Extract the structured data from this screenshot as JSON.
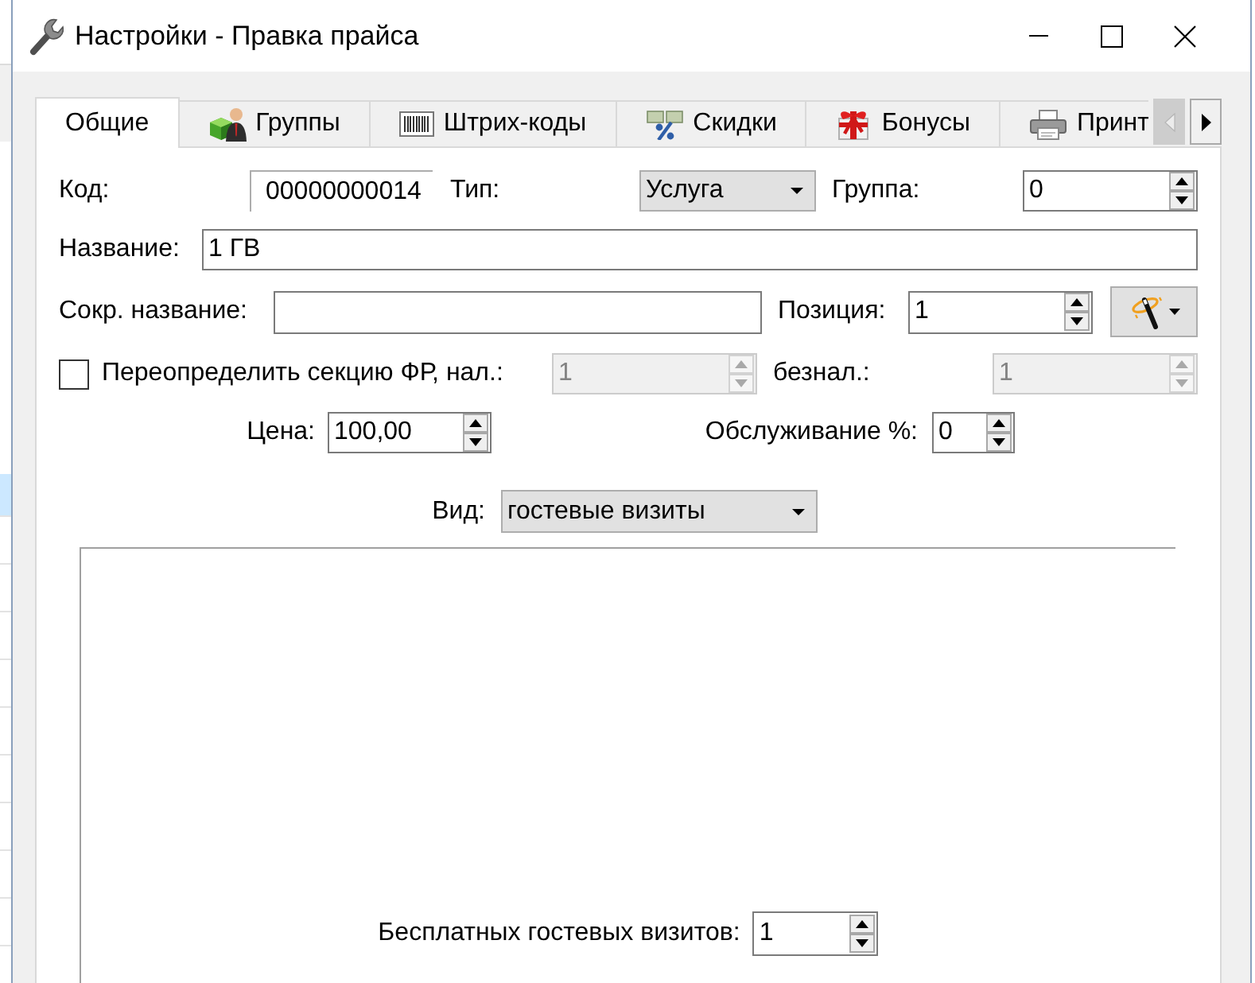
{
  "window": {
    "title": "Настройки - Правка прайса"
  },
  "tabs": [
    {
      "label": "Общие",
      "selected": true
    },
    {
      "label": "Группы",
      "selected": false
    },
    {
      "label": "Штрих-коды",
      "selected": false
    },
    {
      "label": "Скидки",
      "selected": false
    },
    {
      "label": "Бонусы",
      "selected": false
    },
    {
      "label": "Принт",
      "selected": false
    }
  ],
  "tab_scroll": {
    "back_enabled": false,
    "forward_enabled": true
  },
  "form": {
    "code": {
      "label": "Код:",
      "value": "00000000014"
    },
    "type": {
      "label": "Тип:",
      "value": "Услуга"
    },
    "group": {
      "label": "Группа:",
      "value": "0"
    },
    "name": {
      "label": "Название:",
      "value": "1 ГВ"
    },
    "short_name": {
      "label": "Сокр. название:"
    },
    "position": {
      "label": "Позиция:",
      "value": "1"
    },
    "override": {
      "label": "Переопределить секцию ФР, нал.:",
      "checked": false
    },
    "cash_section": {
      "value": "1",
      "disabled": true
    },
    "noncash_section": {
      "label": "безнал.:",
      "value": "1",
      "disabled": true
    },
    "price": {
      "label": "Цена:",
      "value": "100,00"
    },
    "service": {
      "label": "Обслуживание %:",
      "value": "0"
    },
    "view": {
      "label": "Вид:",
      "value": "гостевые визиты"
    },
    "free_visits": {
      "label": "Бесплатных гостевых визитов:",
      "value": "1"
    }
  }
}
